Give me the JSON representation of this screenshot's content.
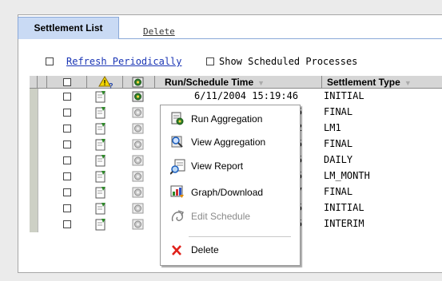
{
  "tabs": {
    "settlement_list": "Settlement List",
    "delete": "Delete"
  },
  "options": {
    "refresh_label": "Refresh Periodically",
    "show_scheduled_label": "Show Scheduled Processes"
  },
  "table": {
    "columns": {
      "run_schedule_time": "Run/Schedule Time",
      "settlement_type": "Settlement Type"
    },
    "rows": [
      {
        "time": "6/11/2004 15:19:46",
        "type": "INITIAL"
      },
      {
        "time": "5",
        "type": "FINAL"
      },
      {
        "time": "2",
        "type": "LM1"
      },
      {
        "time": "5",
        "type": "FINAL"
      },
      {
        "time": "5",
        "type": "DAILY"
      },
      {
        "time": "5",
        "type": "LM_MONTH"
      },
      {
        "time": "7",
        "type": "FINAL"
      },
      {
        "time": "5",
        "type": "INITIAL"
      },
      {
        "time": "5",
        "type": "INTERIM"
      }
    ]
  },
  "context_menu": {
    "items": [
      {
        "label": "Run Aggregation",
        "icon": "run-aggregation-icon",
        "enabled": true
      },
      {
        "label": "View Aggregation",
        "icon": "view-aggregation-icon",
        "enabled": true
      },
      {
        "label": "View Report",
        "icon": "view-report-icon",
        "enabled": true
      },
      {
        "label": "Graph/Download",
        "icon": "graph-download-icon",
        "enabled": true
      },
      {
        "label": "Edit Schedule",
        "icon": "edit-schedule-icon",
        "enabled": false
      },
      {
        "label": "Delete",
        "icon": "delete-icon",
        "enabled": true
      }
    ]
  },
  "colors": {
    "tab_bg": "#c9daf4",
    "link": "#1a35b5",
    "header_bg": "#d6d6d6",
    "gutter": "#cdd0c5",
    "disabled": "#8a8a8a",
    "delete_x": "#e0211a"
  }
}
